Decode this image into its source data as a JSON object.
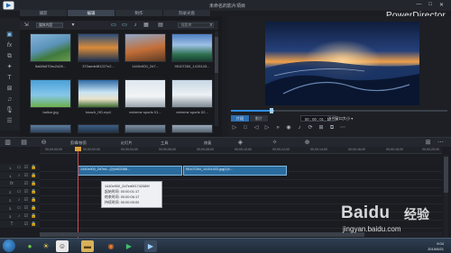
{
  "window": {
    "project_title": "未命名的影片項目",
    "brand": "PowerDirector",
    "controls": [
      "—",
      "□",
      "✕"
    ]
  },
  "tabs": [
    {
      "label": "捕获",
      "active": false
    },
    {
      "label": "编辑",
      "active": true
    },
    {
      "label": "制作",
      "active": false
    },
    {
      "label": "刻录光盘",
      "active": false
    }
  ],
  "library": {
    "filter": "媒体内容",
    "search_placeholder": "搜索库",
    "items": [
      {
        "caption": "5a68b870bc2d28...",
        "scene": "sea"
      },
      {
        "caption": "370aede8f1227e2...",
        "scene": "sunset"
      },
      {
        "caption": "1440x900_2d7...",
        "scene": "canyon"
      },
      {
        "caption": "95107284_1415143...",
        "scene": "lake"
      },
      {
        "caption": "ballon.jpg",
        "scene": "balloon"
      },
      {
        "caption": "beach_HD.mp4",
        "scene": "beach"
      },
      {
        "caption": "extreme sports 01...",
        "scene": "bike"
      },
      {
        "caption": "extreme sports 02...",
        "scene": "jump"
      }
    ]
  },
  "preview": {
    "modes": [
      {
        "label": "片段",
        "active": true
      },
      {
        "label": "影片",
        "active": false
      }
    ],
    "timecode": "00 ; 00 ; 01 ; 17",
    "ratio": "适合窗口大小",
    "progress": 0.2
  },
  "timeline_toolbar": {
    "edit": "剪辑/修剪",
    "slideshow": "幻灯片",
    "tools": "工具",
    "fix": "修复"
  },
  "ruler": {
    "ticks": [
      "00;00;00;00",
      "00;00;02;00",
      "00;00;04;00",
      "00;00;06;00",
      "00;00;08;00",
      "00;00;10;00",
      "00;00;12;00",
      "00;00;14;00",
      "00;00;16;00",
      "00;00;18;00",
      "00;00;20;00"
    ]
  },
  "tracks": [
    {
      "num": "1."
    },
    {
      "num": "1."
    },
    {
      "num": ""
    },
    {
      "num": "2."
    },
    {
      "num": "2."
    },
    {
      "num": "3."
    },
    {
      "num": "3."
    },
    {
      "num": ""
    }
  ],
  "clips": [
    {
      "label": "1440x900_2d7ed...(2)4d52088...",
      "track": 0
    },
    {
      "label": "95107284_14151433.jpg(1)4...",
      "track": 0
    }
  ],
  "tooltip": {
    "lines": [
      "1440x900_2d7ed0f1742089f",
      "起始时间: 00:00:01:17",
      "结束时间: 00:00:06:17",
      "持续时间: 00:00:05:00"
    ]
  },
  "taskbar": {
    "time": "9:04",
    "date": "2019/6/21"
  },
  "watermark": {
    "text": "Baidu",
    "cn": "经验",
    "url": "jingyan.baidu.com"
  },
  "colors": {
    "accent": "#2f8ddf",
    "clip": "#2b6c9e",
    "playhead": "#d64a4a"
  }
}
